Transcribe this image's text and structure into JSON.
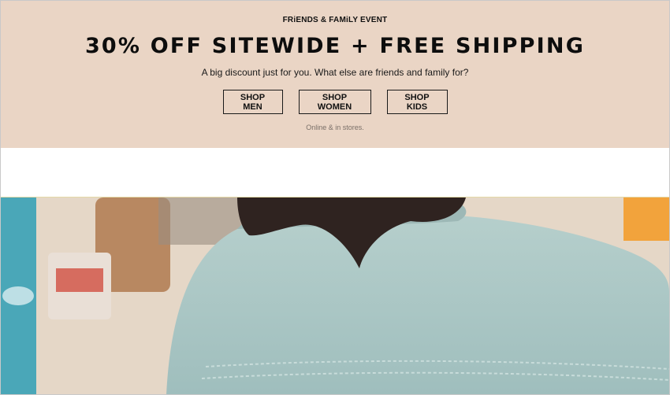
{
  "promo": {
    "eyebrow": "FRiENDS & FAMiLY EVENT",
    "headline": "30% OFF SITEWIDE + FREE SHIPPING",
    "subtext": "A big discount just for you. What else are friends and family for?",
    "buttons": [
      {
        "label": "SHOP MEN"
      },
      {
        "label": "SHOP WOMEN"
      },
      {
        "label": "SHOP KIDS"
      }
    ],
    "note": "Online & in stores."
  },
  "hero": {
    "image": "person-in-denim-jacket-back-view"
  },
  "colors": {
    "promo_background": "#ead5c5",
    "text": "#111111",
    "denim": "#a9c6c4"
  }
}
